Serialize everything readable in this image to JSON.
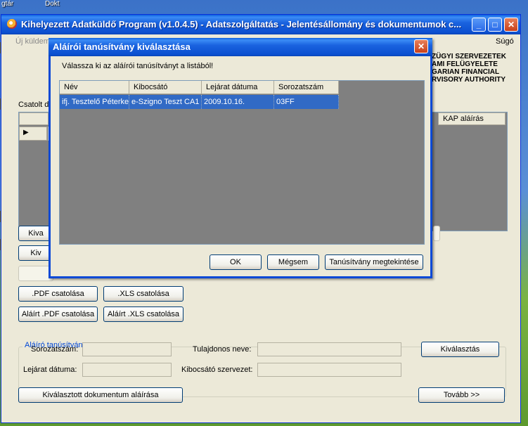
{
  "desktop": {
    "labels": [
      "gtár",
      "Dokt"
    ]
  },
  "window": {
    "title": "Kihelyezett Adatküldő Program (v1.0.4.5) - Adatszolgáltatás - Jelentésállomány és dokumentumok c...",
    "min_glyph": "_",
    "max_glyph": "□",
    "close_glyph": "✕"
  },
  "menu": {
    "new_send": "Új küldem",
    "help": "Súgó"
  },
  "logo": {
    "lines": [
      "ZÜGYI SZERVEZETEK",
      "AMI FELÜGYELETE",
      "GARIAN FINANCIAL",
      "RVISORY AUTHORITY"
    ]
  },
  "attached": {
    "label": "Csatolt d",
    "grid_last_header": "KAP aláírás",
    "row_marker": "▶"
  },
  "left_buttons": {
    "b1": "Kiva",
    "b2": "Kiv"
  },
  "attach_buttons": {
    "pdf": ".PDF csatolása",
    "xls": ".XLS csatolása",
    "signed_pdf": "Aláírt .PDF csatolása",
    "signed_xls": "Aláírt .XLS csatolása"
  },
  "signer_cert": {
    "group_title": "Aláíró tanúsítvány",
    "serial_label": "Sorozatszám:",
    "owner_label": "Tulajdonos neve:",
    "select_button": "Kiválasztás",
    "expiry_label": "Lejárat dátuma:",
    "issuer_label": "Kibocsátó szervezet:"
  },
  "bottom": {
    "sign_button": "Kiválasztott dokumentum aláírása",
    "next_button": "Tovább >>"
  },
  "dialog": {
    "title": "Aláírói tanúsítvány kiválasztása",
    "close_glyph": "✕",
    "prompt": "Válassza ki az aláírói tanúsítványt a listából!",
    "columns": [
      "Név",
      "Kibocsátó",
      "Lejárat dátuma",
      "Sorozatszám"
    ],
    "rows": [
      [
        "ifj. Tesztelő Péterke",
        "e-Szigno Teszt CA1",
        "2009.10.16.",
        "03FF"
      ]
    ],
    "ok_button": "OK",
    "cancel_button": "Mégsem",
    "view_button": "Tanúsítvány megtekintése"
  },
  "colors": {
    "titlebar": "#0b4fd0",
    "selection": "#316ac5",
    "window_bg": "#ece9d8",
    "list_bg": "#808080",
    "group_title": "#0046d5"
  }
}
